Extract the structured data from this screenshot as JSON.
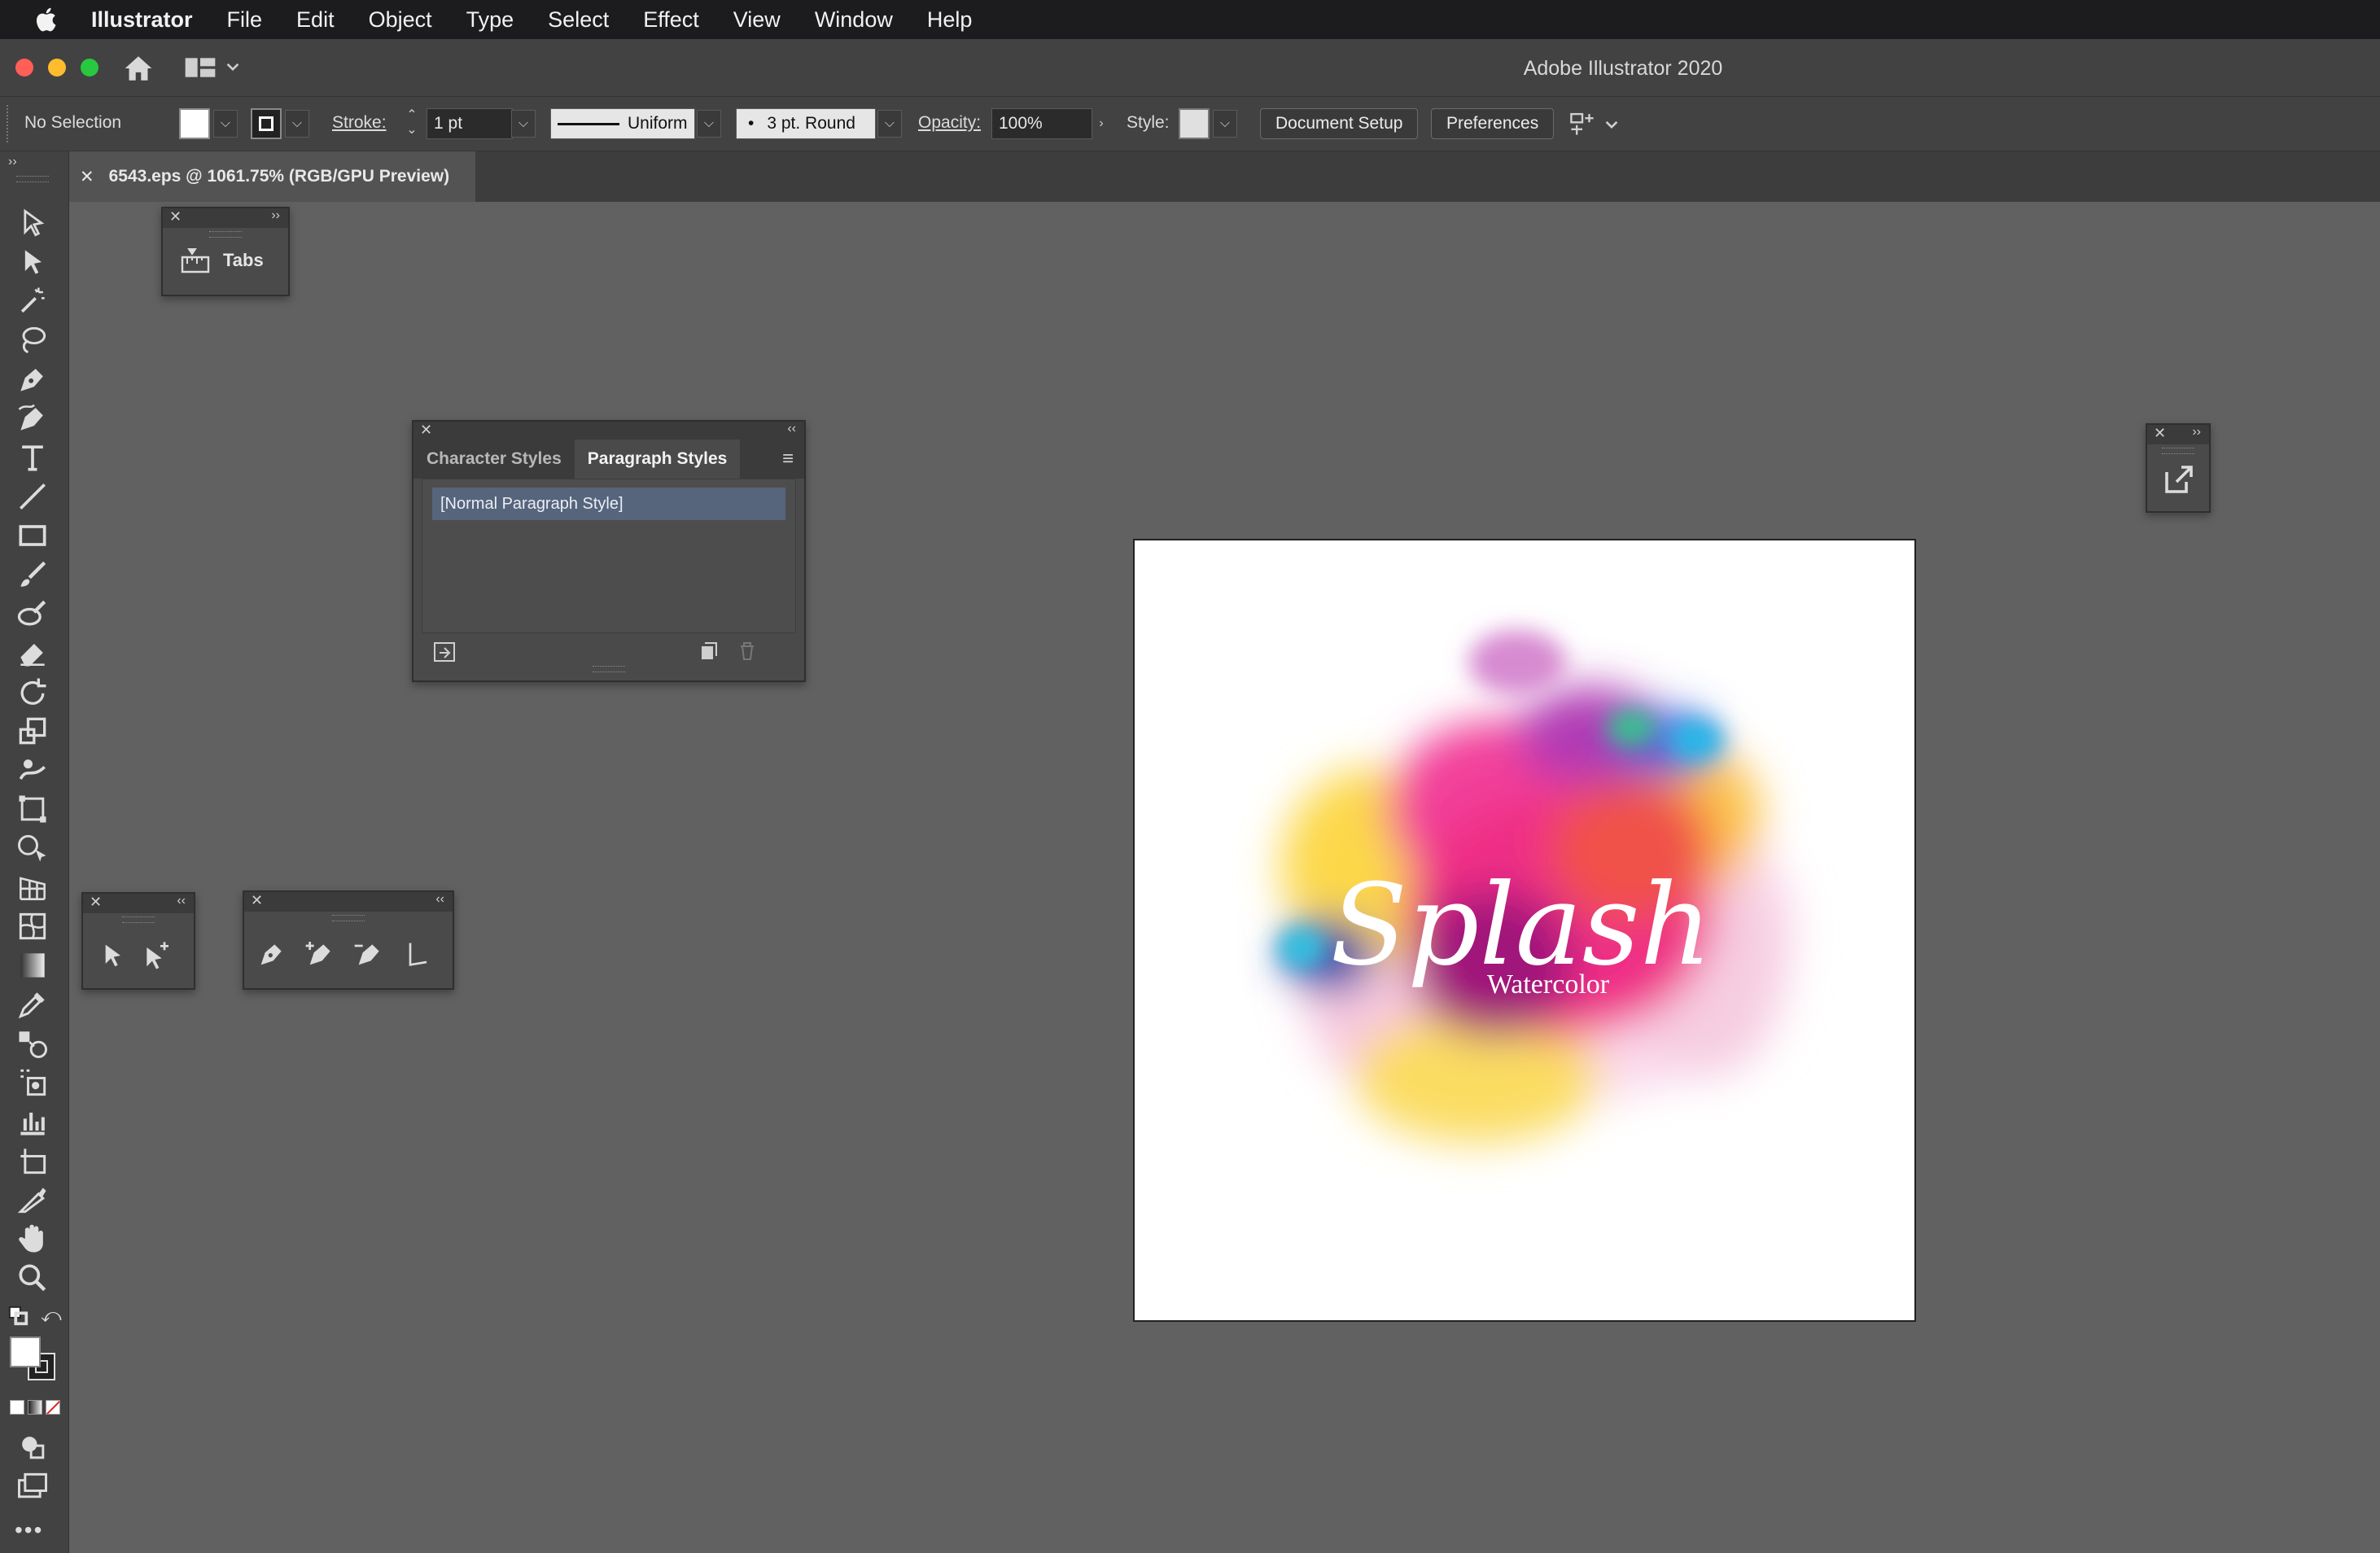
{
  "menubar": {
    "app_name": "Illustrator",
    "items": [
      "File",
      "Edit",
      "Object",
      "Type",
      "Select",
      "Effect",
      "View",
      "Window",
      "Help"
    ]
  },
  "window": {
    "title": "Adobe Illustrator 2020"
  },
  "controlbar": {
    "selection": "No Selection",
    "stroke_label": "Stroke:",
    "stroke_weight": "1 pt",
    "profile": "Uniform",
    "brush": "3 pt. Round",
    "opacity_label": "Opacity:",
    "opacity_value": "100%",
    "style_label": "Style:",
    "document_setup": "Document Setup",
    "preferences": "Preferences"
  },
  "document": {
    "tab_title": "6543.eps @ 1061.75% (RGB/GPU Preview)"
  },
  "tabs_panel": {
    "label": "Tabs"
  },
  "styles_panel": {
    "tabs": [
      "Character Styles",
      "Paragraph Styles"
    ],
    "active_tab": "Paragraph Styles",
    "items": [
      "[Normal Paragraph Style]"
    ]
  },
  "artwork": {
    "title": "Splash",
    "subtitle": "Watercolor"
  },
  "colors": {
    "canvas": "#616161",
    "chrome": "#424242",
    "menubar": "#1c1c1e",
    "selected_item": "#56657c",
    "close_light": "#ff5f57",
    "min_light": "#febc2e",
    "max_light": "#28c840"
  }
}
